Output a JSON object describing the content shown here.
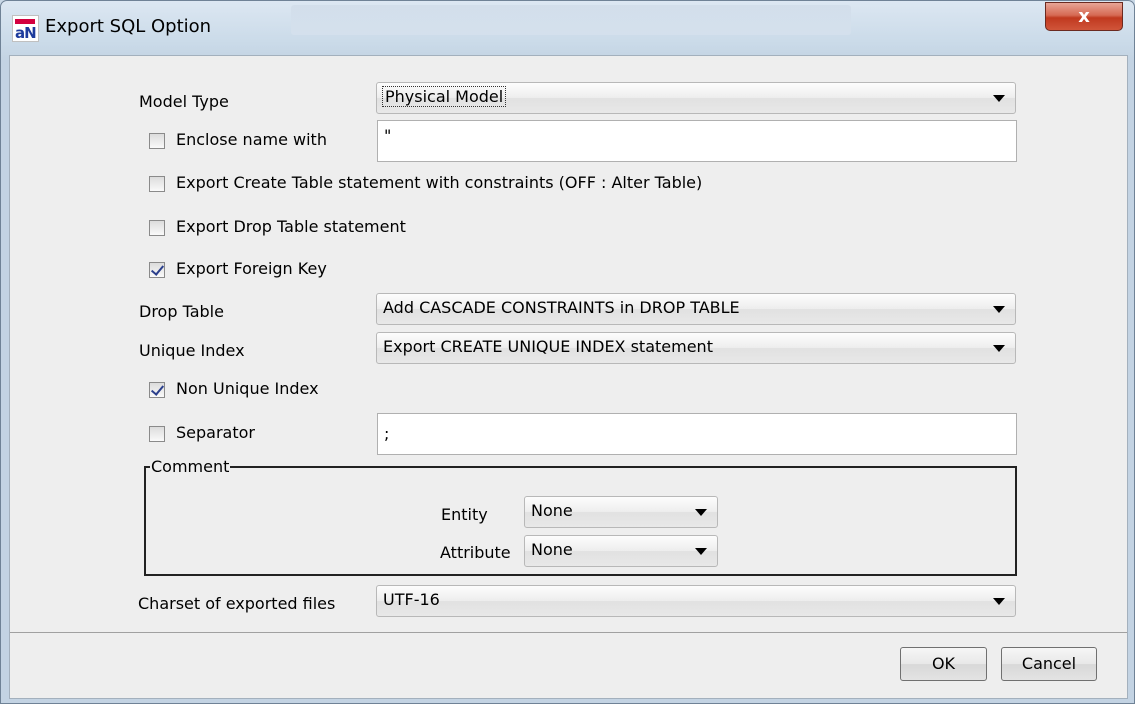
{
  "window": {
    "title": "Export SQL Option",
    "app_icon_text": "aN",
    "close_symbol": "x"
  },
  "model_type": {
    "label": "Model Type",
    "value": "Physical Model"
  },
  "enclose_name": {
    "label": "Enclose name with",
    "checked": false,
    "value": "\""
  },
  "export_create_table": {
    "label": "Export Create Table statement with constraints (OFF : Alter Table)",
    "checked": false
  },
  "export_drop_table": {
    "label": "Export Drop Table statement",
    "checked": false
  },
  "export_foreign_key": {
    "label": "Export Foreign Key",
    "checked": true
  },
  "drop_table": {
    "label": "Drop Table",
    "value": "Add CASCADE CONSTRAINTS in DROP TABLE"
  },
  "unique_index": {
    "label": "Unique Index",
    "value": "Export CREATE UNIQUE INDEX statement"
  },
  "non_unique_index": {
    "label": "Non Unique Index",
    "checked": true
  },
  "separator": {
    "label": "Separator",
    "checked": false,
    "value": ";"
  },
  "comment": {
    "title": "Comment",
    "entity": {
      "label": "Entity",
      "value": "None"
    },
    "attribute": {
      "label": "Attribute",
      "value": "None"
    }
  },
  "charset": {
    "label": "Charset of exported files",
    "value": "UTF-16"
  },
  "buttons": {
    "ok": "OK",
    "cancel": "Cancel"
  }
}
